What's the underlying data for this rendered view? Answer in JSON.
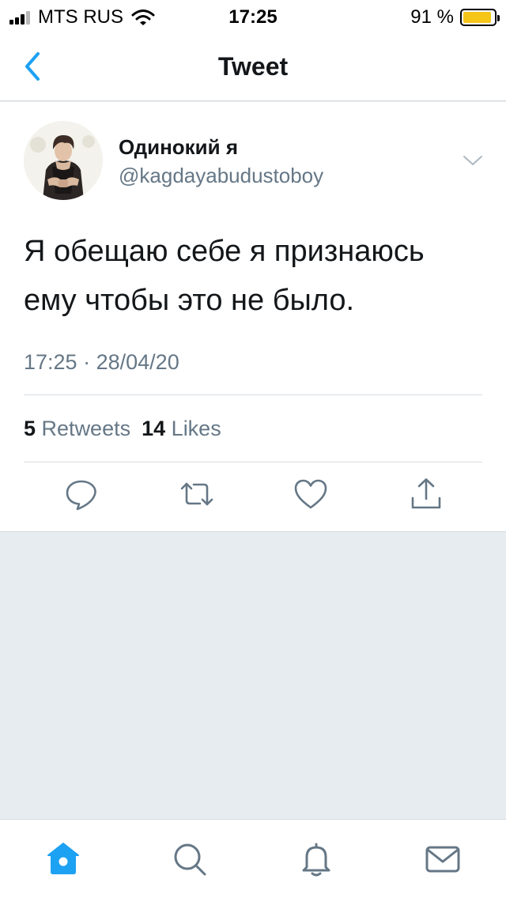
{
  "status_bar": {
    "carrier": "MTS RUS",
    "time": "17:25",
    "battery_percent": "91 %",
    "battery_level": 0.91,
    "battery_color": "#f5c518",
    "signal_bars": 3
  },
  "nav": {
    "title": "Tweet",
    "back_icon": "chevron-left-icon"
  },
  "tweet": {
    "author_name": "Одинокий я",
    "author_handle": "@kagdayabudustoboy",
    "text_line1": "Я обещаю себе я признаюсь",
    "text_line2": "ему чтобы это не было.",
    "time": "17:25",
    "separator": "·",
    "date": "28/04/20",
    "retweets_count": "5",
    "retweets_label": "Retweets",
    "likes_count": "14",
    "likes_label": "Likes"
  },
  "actions": [
    {
      "name": "reply",
      "icon": "reply-icon"
    },
    {
      "name": "retweet",
      "icon": "retweet-icon"
    },
    {
      "name": "like",
      "icon": "heart-icon"
    },
    {
      "name": "share",
      "icon": "share-icon"
    }
  ],
  "tab_bar": [
    {
      "name": "home",
      "icon": "home-icon",
      "active": true
    },
    {
      "name": "search",
      "icon": "search-icon",
      "active": false
    },
    {
      "name": "notifications",
      "icon": "bell-icon",
      "active": false
    },
    {
      "name": "messages",
      "icon": "mail-icon",
      "active": false
    }
  ],
  "colors": {
    "accent": "#1da1f2",
    "icon_gray": "#657786",
    "text": "#14171a",
    "background": "#e6ecf0"
  }
}
